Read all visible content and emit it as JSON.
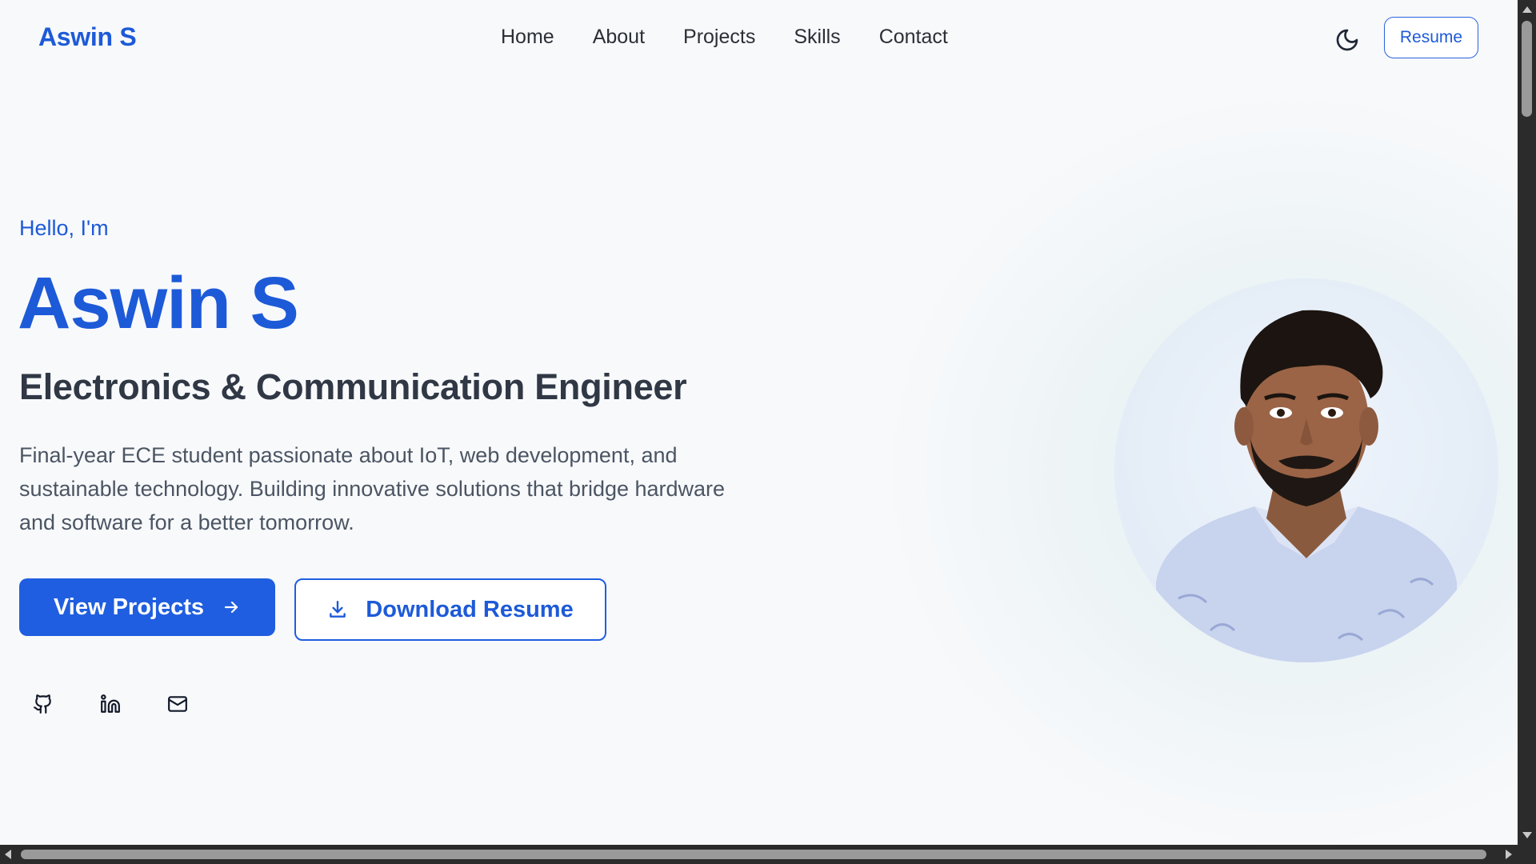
{
  "nav": {
    "logo": "Aswin S",
    "links": [
      "Home",
      "About",
      "Projects",
      "Skills",
      "Contact"
    ],
    "theme_icon": "moon-icon",
    "resume_label": "Resume"
  },
  "hero": {
    "greeting": "Hello, I'm",
    "name": "Aswin S",
    "role": "Electronics & Communication Engineer",
    "description": "Final-year ECE student passionate about IoT, web development, and sustainable technology. Building innovative solutions that bridge hardware and software for a better tomorrow.",
    "primary_button": "View Projects",
    "primary_button_icon": "arrow-right-icon",
    "secondary_button": "Download Resume",
    "secondary_button_icon": "download-icon",
    "socials": [
      "github-icon",
      "linkedin-icon",
      "mail-icon"
    ],
    "portrait_alt": "profile-photo"
  },
  "colors": {
    "accent": "#1d5ad8",
    "heading": "#303845",
    "body_text": "#4b5563",
    "background": "#f8f9fb"
  }
}
